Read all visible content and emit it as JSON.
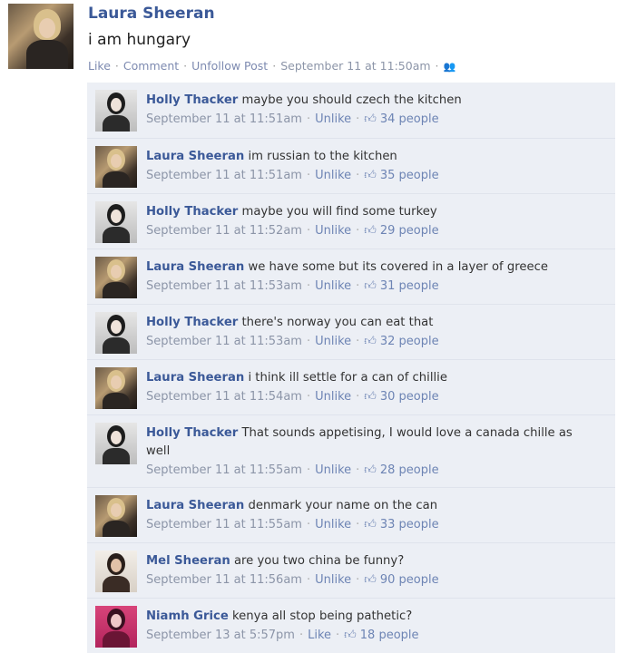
{
  "post": {
    "author": "Laura Sheeran",
    "text": "i am hungary",
    "like_label": "Like",
    "comment_label": "Comment",
    "unfollow_label": "Unfollow Post",
    "timestamp": "September 11 at 11:50am",
    "audience_icon": "friends-icon"
  },
  "comments": [
    {
      "author": "Holly Thacker",
      "text": "maybe you should czech the kitchen",
      "time": "September 11 at 11:51am",
      "action": "Unlike",
      "likes": "34 people",
      "avatar": "holly"
    },
    {
      "author": "Laura Sheeran",
      "text": "im russian to the kitchen",
      "time": "September 11 at 11:51am",
      "action": "Unlike",
      "likes": "35 people",
      "avatar": "laura"
    },
    {
      "author": "Holly Thacker",
      "text": "maybe you will find some turkey",
      "time": "September 11 at 11:52am",
      "action": "Unlike",
      "likes": "29 people",
      "avatar": "holly"
    },
    {
      "author": "Laura Sheeran",
      "text": "we have some but its covered in a layer of greece",
      "time": "September 11 at 11:53am",
      "action": "Unlike",
      "likes": "31 people",
      "avatar": "laura"
    },
    {
      "author": "Holly Thacker",
      "text": "there's norway you can eat that",
      "time": "September 11 at 11:53am",
      "action": "Unlike",
      "likes": "32 people",
      "avatar": "holly"
    },
    {
      "author": "Laura Sheeran",
      "text": "i think ill settle for a can of chillie",
      "time": "September 11 at 11:54am",
      "action": "Unlike",
      "likes": "30 people",
      "avatar": "laura"
    },
    {
      "author": "Holly Thacker",
      "text": "That sounds appetising, I would love a canada chille as well",
      "time": "September 11 at 11:55am",
      "action": "Unlike",
      "likes": "28 people",
      "avatar": "holly"
    },
    {
      "author": "Laura Sheeran",
      "text": "denmark your name on the can",
      "time": "September 11 at 11:55am",
      "action": "Unlike",
      "likes": "33 people",
      "avatar": "laura"
    },
    {
      "author": "Mel Sheeran",
      "text": "are you two china be funny?",
      "time": "September 11 at 11:56am",
      "action": "Unlike",
      "likes": "90 people",
      "avatar": "mel"
    },
    {
      "author": "Niamh Grice",
      "text": "kenya all stop being pathetic?",
      "time": "September 13 at 5:57pm",
      "action": "Like",
      "likes": "18 people",
      "avatar": "niamh"
    }
  ],
  "colors": {
    "link": "#3b5998",
    "comment_bg": "#eceff5",
    "meta": "#8c95a8"
  }
}
